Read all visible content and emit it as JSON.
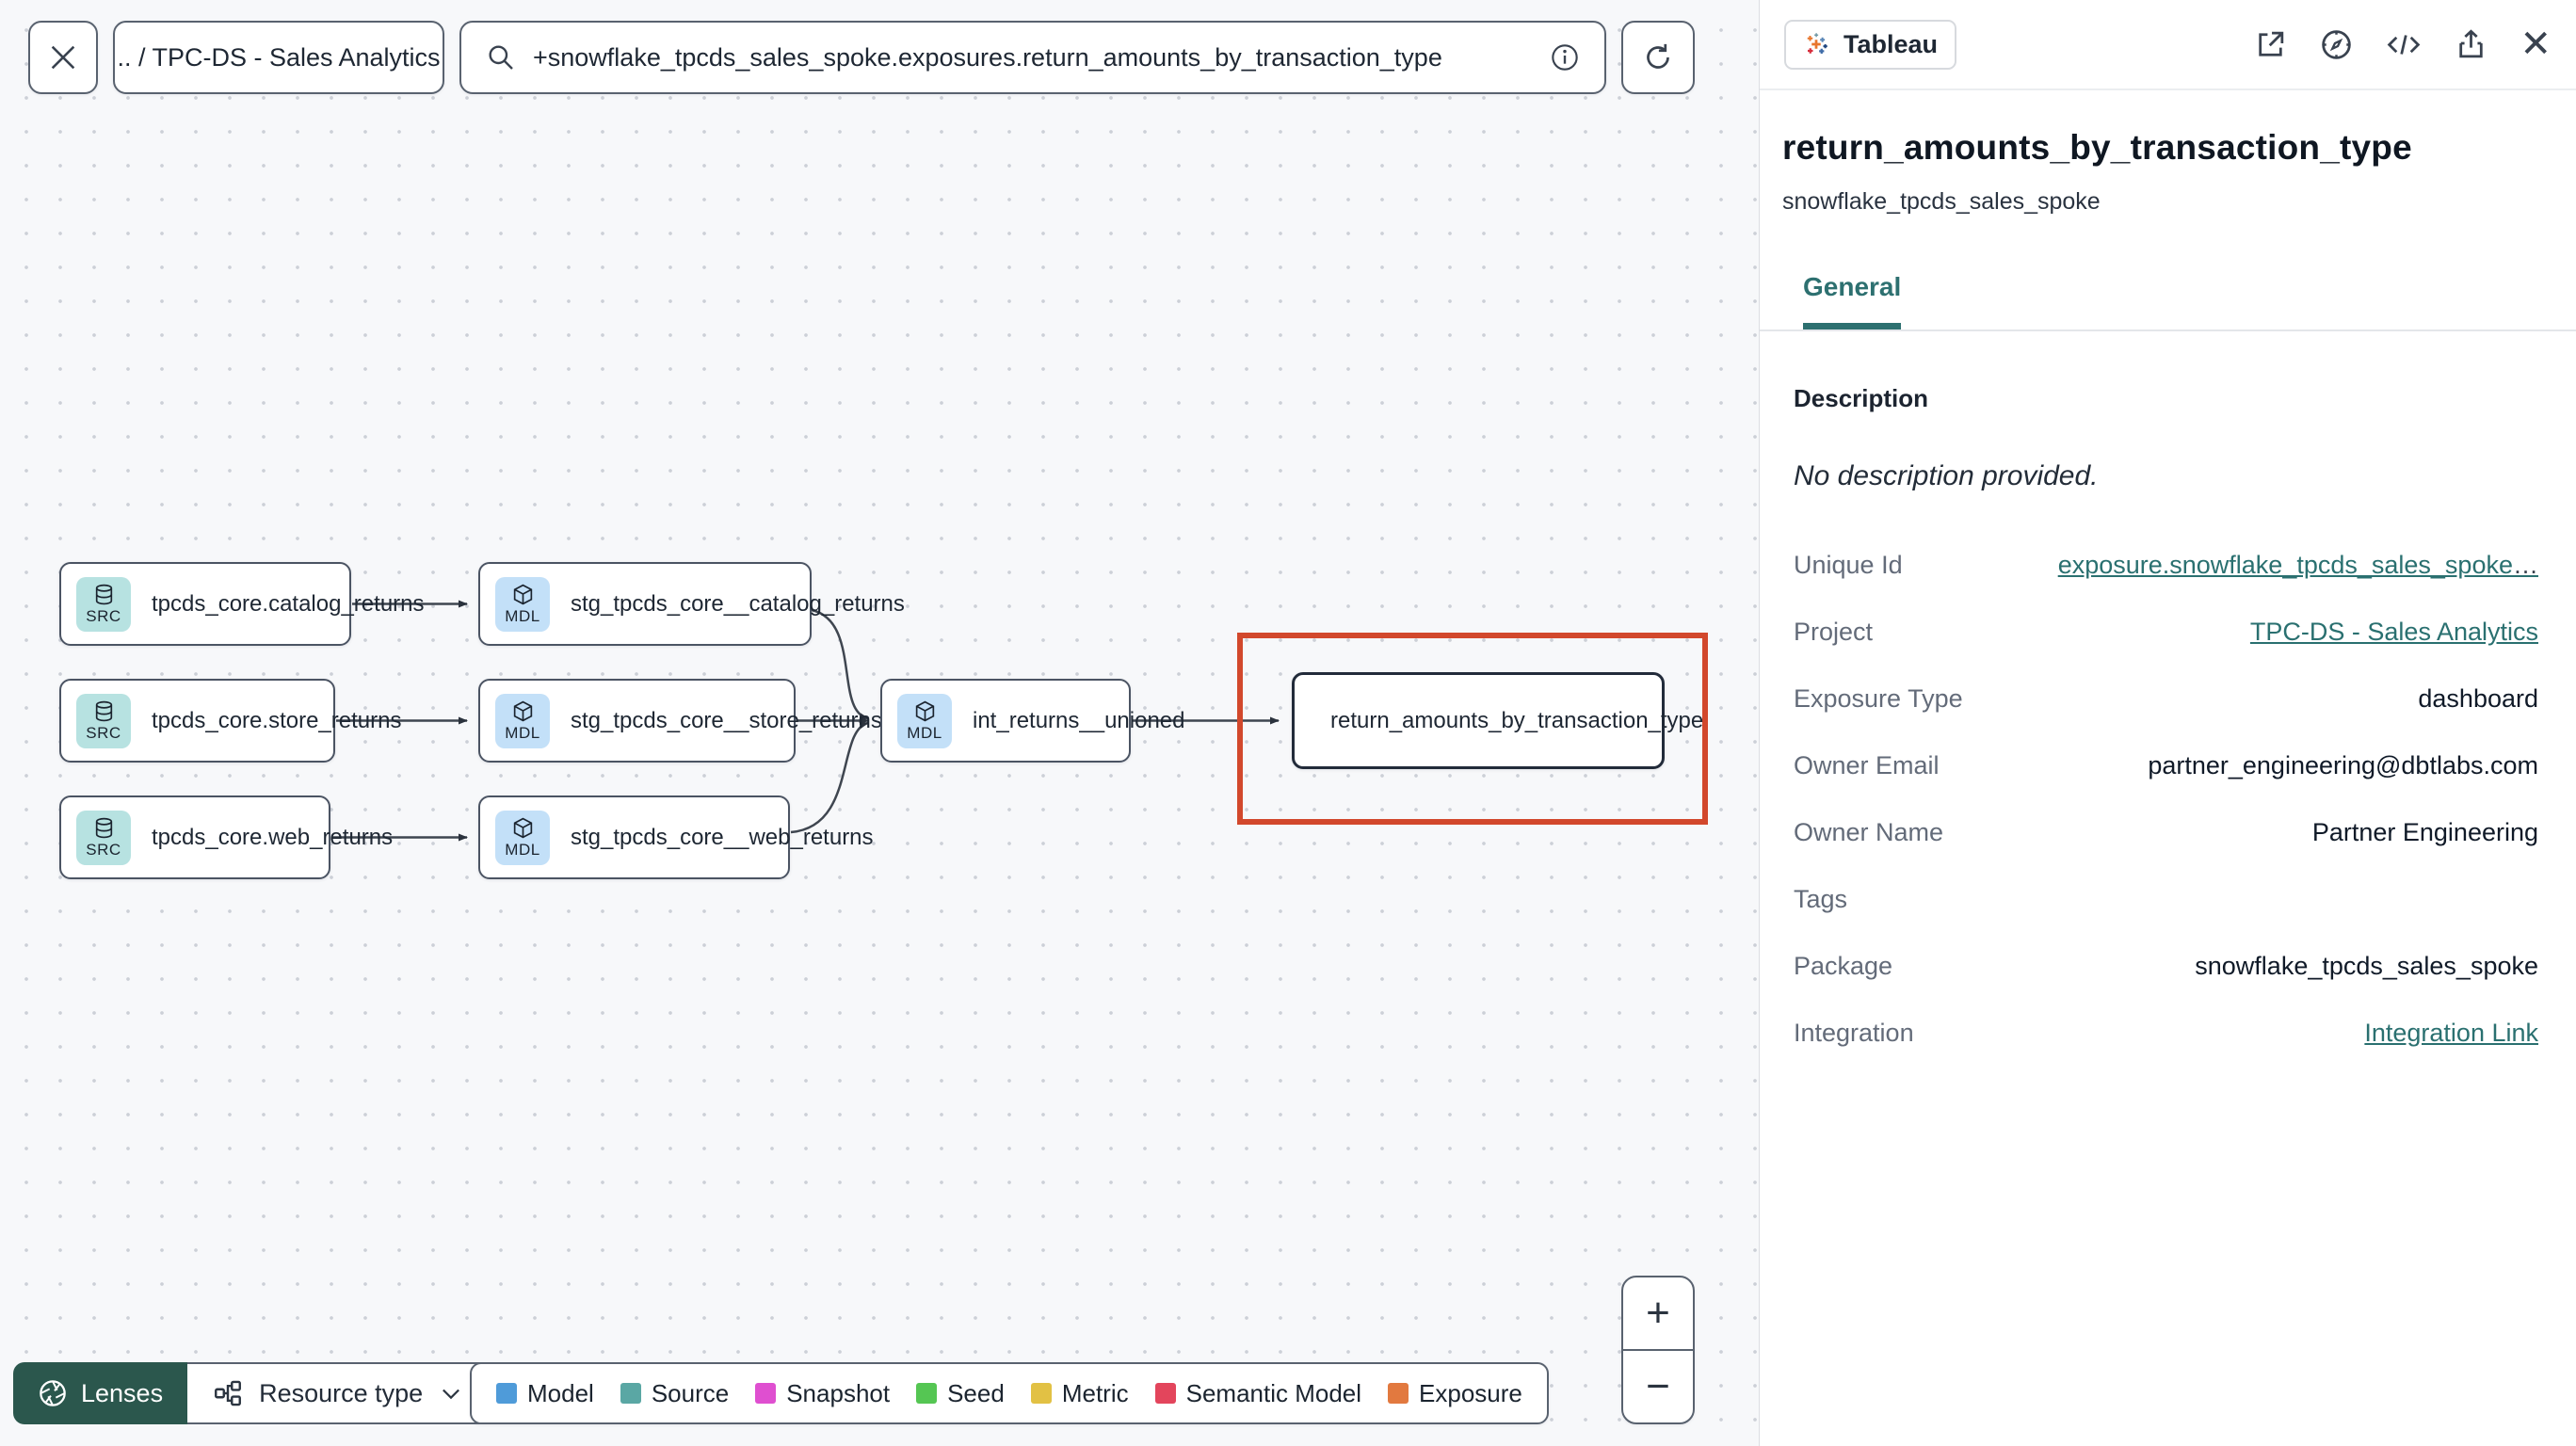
{
  "topbar": {
    "breadcrumb": ".. / TPC-DS - Sales Analytics",
    "search_value": "+snowflake_tpcds_sales_spoke.exposures.return_amounts_by_transaction_type"
  },
  "graph": {
    "nodes": [
      {
        "badge": "SRC",
        "label": "tpcds_core.catalog_returns"
      },
      {
        "badge": "SRC",
        "label": "tpcds_core.store_returns"
      },
      {
        "badge": "SRC",
        "label": "tpcds_core.web_returns"
      },
      {
        "badge": "MDL",
        "label": "stg_tpcds_core__catalog_returns"
      },
      {
        "badge": "MDL",
        "label": "stg_tpcds_core__store_returns"
      },
      {
        "badge": "MDL",
        "label": "stg_tpcds_core__web_returns"
      },
      {
        "badge": "MDL",
        "label": "int_returns__unioned"
      },
      {
        "badge": "tableau",
        "label": "return_amounts_by_transaction_type"
      }
    ]
  },
  "toolbar": {
    "lenses": "Lenses",
    "resource_type": "Resource type"
  },
  "legend": {
    "items": [
      {
        "label": "Model",
        "color": "#4f9bd9"
      },
      {
        "label": "Source",
        "color": "#5aa7a4"
      },
      {
        "label": "Snapshot",
        "color": "#df4fd0"
      },
      {
        "label": "Seed",
        "color": "#55c653"
      },
      {
        "label": "Metric",
        "color": "#e2c144"
      },
      {
        "label": "Semantic Model",
        "color": "#e3455c"
      },
      {
        "label": "Exposure",
        "color": "#e2793f"
      }
    ]
  },
  "zoom_controls": {
    "zoom_in": "+",
    "zoom_out": "−"
  },
  "panel": {
    "integration_badge": "Tableau",
    "title": "return_amounts_by_transaction_type",
    "subtitle": "snowflake_tpcds_sales_spoke",
    "active_tab": "General",
    "description_heading": "Description",
    "description_empty": "No description provided.",
    "fields": [
      {
        "label": "Unique Id",
        "value": "exposure.snowflake_tpcds_sales_spoke",
        "suffix": "…"
      },
      {
        "label": "Project",
        "value": "TPC-DS - Sales Analytics"
      },
      {
        "label": "Exposure Type",
        "value": "dashboard"
      },
      {
        "label": "Owner Email",
        "value": "partner_engineering@dbtlabs.com"
      },
      {
        "label": "Owner Name",
        "value": "Partner Engineering"
      },
      {
        "label": "Tags",
        "value": ""
      },
      {
        "label": "Package",
        "value": "snowflake_tpcds_sales_spoke"
      },
      {
        "label": "Integration",
        "value": "Integration Link"
      }
    ],
    "accent_teal": "#2d7070",
    "highlight_red": "#d2482c"
  }
}
